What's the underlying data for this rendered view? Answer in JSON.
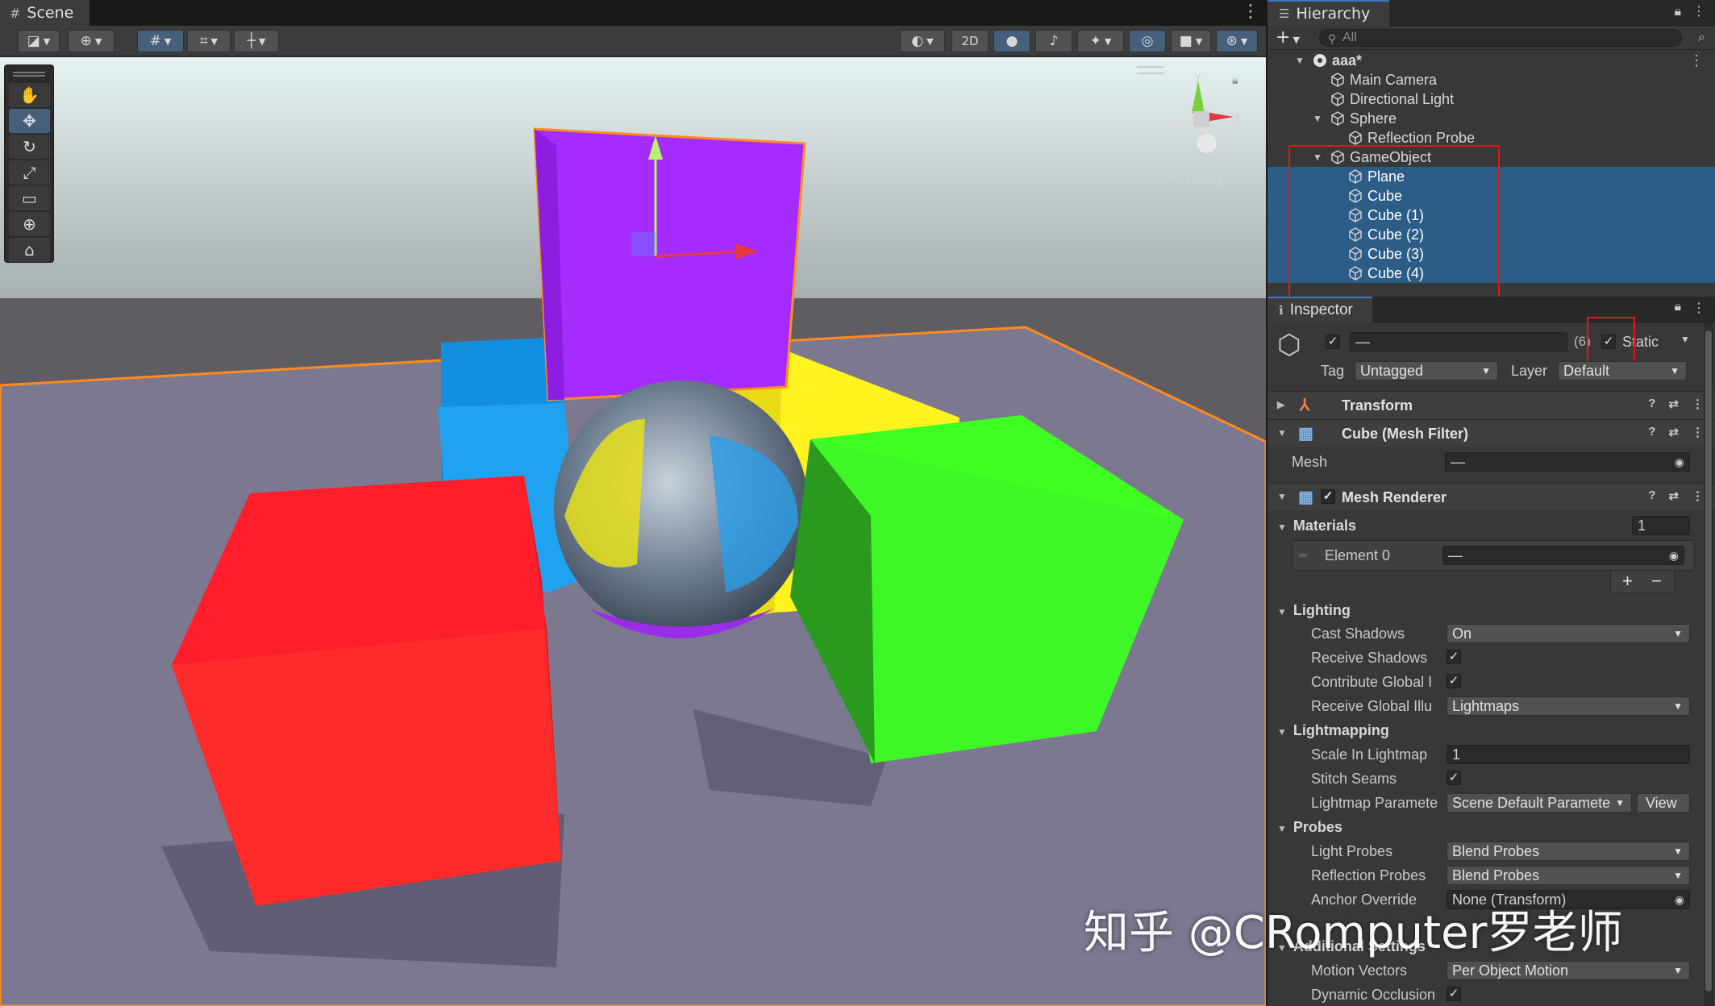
{
  "scene": {
    "tab_label": "Scene",
    "toolbar": {
      "mode_2d": "2D"
    },
    "persp_label": "< Persp",
    "gizmo_axis_x": "x",
    "gizmo_axis_y": "y",
    "objects": [
      {
        "name": "Cube",
        "color": "#a52bff"
      },
      {
        "name": "Cube",
        "color": "#1fa3f0"
      },
      {
        "name": "Cube",
        "color": "#fff21e"
      },
      {
        "name": "Cube",
        "color": "#ff1e2a"
      },
      {
        "name": "Cube",
        "color": "#3fff22"
      },
      {
        "name": "Sphere",
        "color": "#9aa7b8"
      },
      {
        "name": "Plane",
        "color": "#7b7890"
      }
    ]
  },
  "hierarchy": {
    "tab_label": "Hierarchy",
    "search_placeholder": "All",
    "items": [
      {
        "label": "aaa*",
        "depth": 0,
        "expanded": true,
        "selected": false,
        "scene": true
      },
      {
        "label": "Main Camera",
        "depth": 1,
        "selected": false
      },
      {
        "label": "Directional Light",
        "depth": 1,
        "selected": false
      },
      {
        "label": "Sphere",
        "depth": 1,
        "expanded": true,
        "selected": false
      },
      {
        "label": "Reflection Probe",
        "depth": 2,
        "selected": false
      },
      {
        "label": "GameObject",
        "depth": 1,
        "expanded": true,
        "selected": false
      },
      {
        "label": "Plane",
        "depth": 2,
        "selected": true
      },
      {
        "label": "Cube",
        "depth": 2,
        "selected": true
      },
      {
        "label": "Cube (1)",
        "depth": 2,
        "selected": true
      },
      {
        "label": "Cube (2)",
        "depth": 2,
        "selected": true
      },
      {
        "label": "Cube (3)",
        "depth": 2,
        "selected": true
      },
      {
        "label": "Cube (4)",
        "depth": 2,
        "selected": true
      }
    ]
  },
  "inspector": {
    "tab_label": "Inspector",
    "name_value": "—",
    "count_badge": "(6)",
    "static_label": "Static",
    "tag_label": "Tag",
    "tag_value": "Untagged",
    "layer_label": "Layer",
    "layer_value": "Default",
    "components": {
      "transform": "Transform",
      "mesh_filter": "Cube (Mesh Filter)",
      "mesh_renderer": "Mesh Renderer"
    },
    "mesh_label": "Mesh",
    "mesh_value": "—",
    "materials_label": "Materials",
    "materials_count": "1",
    "element0_label": "Element 0",
    "element0_value": "—",
    "plus": "+",
    "minus": "−",
    "lighting": {
      "title": "Lighting",
      "cast_shadows_label": "Cast Shadows",
      "cast_shadows_value": "On",
      "receive_shadows_label": "Receive Shadows",
      "contribute_gi_label": "Contribute Global I",
      "receive_gi_label": "Receive Global Illu",
      "receive_gi_value": "Lightmaps"
    },
    "lightmapping": {
      "title": "Lightmapping",
      "scale_label": "Scale In Lightmap",
      "scale_value": "1",
      "stitch_label": "Stitch Seams",
      "params_label": "Lightmap Paramete",
      "params_value": "Scene Default Paramete",
      "view_button": "View"
    },
    "probes": {
      "title": "Probes",
      "light_label": "Light Probes",
      "light_value": "Blend Probes",
      "reflection_label": "Reflection Probes",
      "reflection_value": "Blend Probes",
      "anchor_label": "Anchor Override",
      "anchor_value": "None (Transform)"
    },
    "additional": {
      "title": "Additional Settings",
      "motion_label": "Motion Vectors",
      "motion_value": "Per Object Motion",
      "occlusion_label": "Dynamic Occlusion"
    }
  },
  "watermark": "知乎 @CRomputer罗老师"
}
